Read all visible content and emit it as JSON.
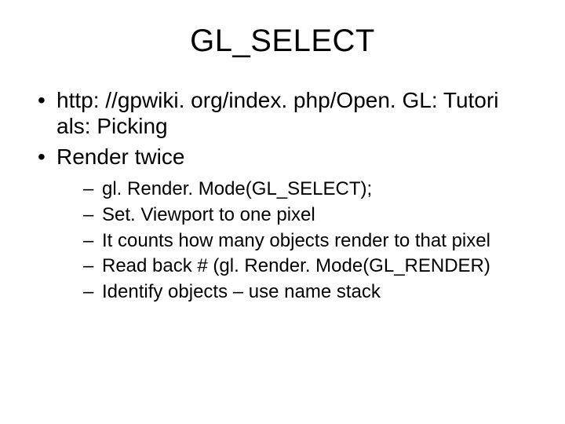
{
  "title": "GL_SELECT",
  "bullets": [
    {
      "text": "http: //gpwiki. org/index. php/Open. GL: Tutori als: Picking"
    },
    {
      "text": "Render twice"
    }
  ],
  "subbullets": [
    {
      "text": "gl. Render. Mode(GL_SELECT);"
    },
    {
      "text": "Set. Viewport to one pixel"
    },
    {
      "text": "It counts how many objects render to that pixel"
    },
    {
      "text": "Read back # (gl. Render. Mode(GL_RENDER)"
    },
    {
      "text": "Identify objects – use name stack"
    }
  ]
}
